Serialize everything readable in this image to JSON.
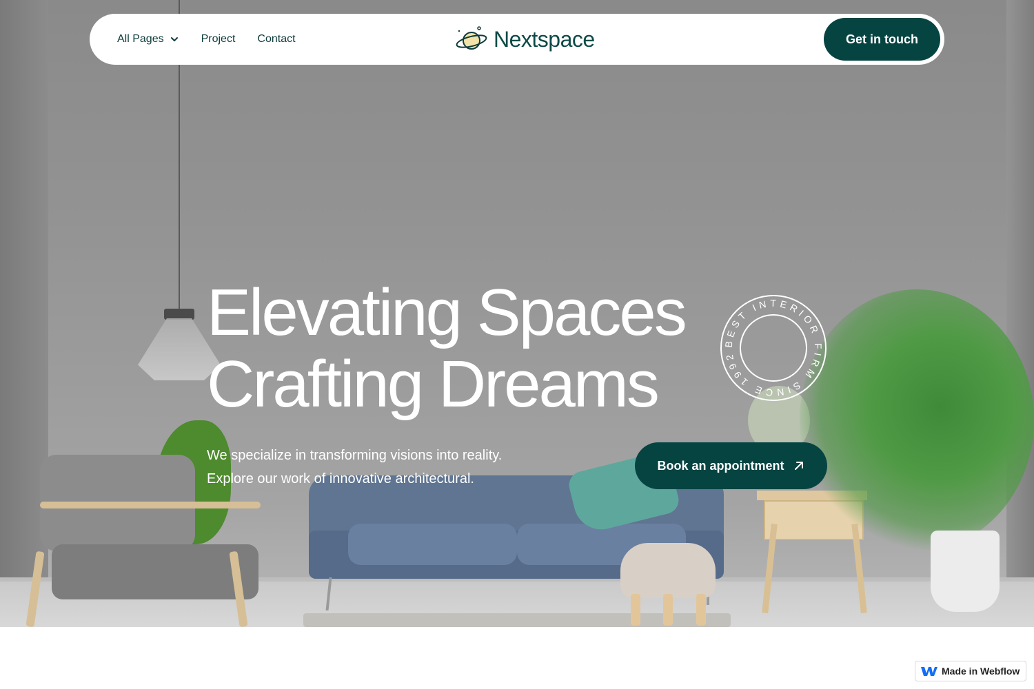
{
  "nav": {
    "links": [
      {
        "label": "All Pages",
        "has_dropdown": true
      },
      {
        "label": "Project"
      },
      {
        "label": "Contact"
      }
    ],
    "logo_text": "Nextspace",
    "cta_label": "Get in touch"
  },
  "hero": {
    "headline_line1": "Elevating Spaces",
    "headline_line2": "Crafting Dreams",
    "subtext_line1": "We specialize in transforming visions into reality.",
    "subtext_line2": "Explore our work of innovative architectural.",
    "cta_label": "Book an appointment",
    "cta_icon": "arrow-up-right-icon",
    "badge_text": "BEST INTERIOR FIRM SINCE 1992 •"
  },
  "webflow_badge": {
    "label": "Made in Webflow"
  },
  "colors": {
    "brand_dark_teal": "#064442",
    "logo_teal": "#0d4a47",
    "nav_text": "#0d3b3c",
    "white": "#ffffff"
  }
}
